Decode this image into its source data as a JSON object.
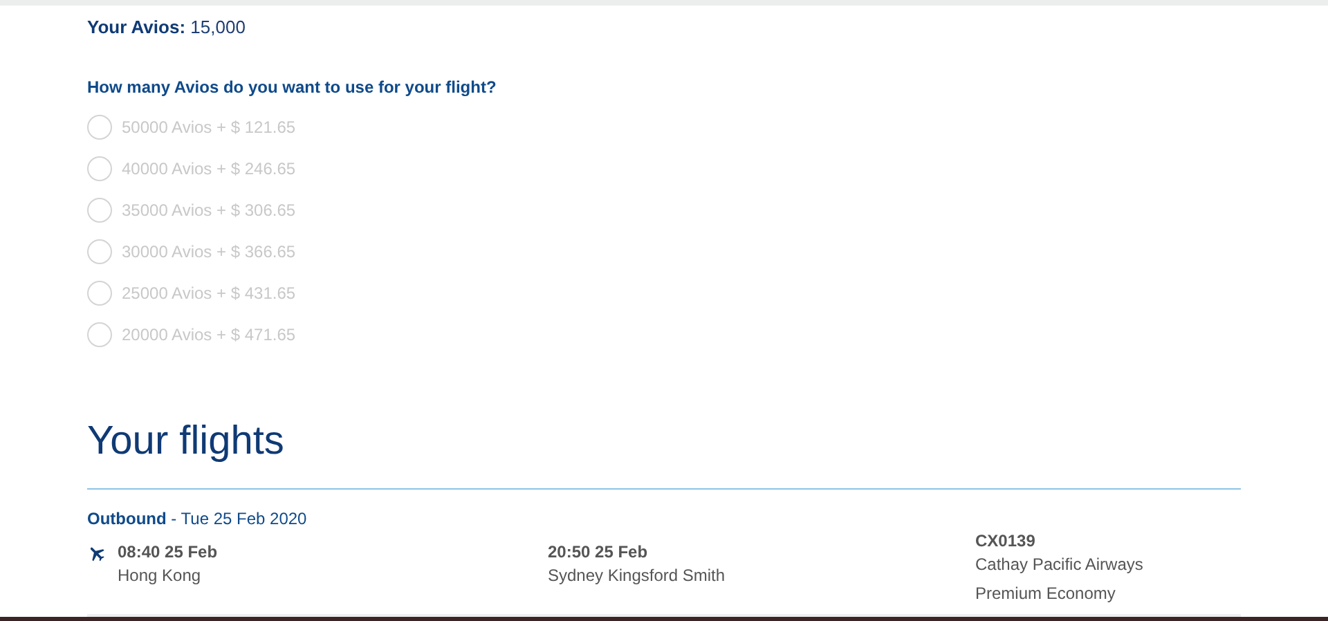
{
  "avios_balance": {
    "label": "Your Avios:",
    "value": "15,000"
  },
  "question": "How many Avios do you want to use for your flight?",
  "options": [
    {
      "label": "50000 Avios + $ 121.65",
      "selected": false,
      "disabled": true
    },
    {
      "label": "40000 Avios + $ 246.65",
      "selected": false,
      "disabled": true
    },
    {
      "label": "35000 Avios + $ 306.65",
      "selected": false,
      "disabled": true
    },
    {
      "label": "30000 Avios + $ 366.65",
      "selected": false,
      "disabled": true
    },
    {
      "label": "25000 Avios + $ 431.65",
      "selected": false,
      "disabled": true
    },
    {
      "label": "20000 Avios + $ 471.65",
      "selected": false,
      "disabled": true
    }
  ],
  "flights": {
    "title": "Your flights",
    "outbound": {
      "label": "Outbound",
      "date": "- Tue 25 Feb 2020",
      "departure": {
        "time": "08:40 25 Feb",
        "place": "Hong Kong"
      },
      "arrival": {
        "time": "20:50 25 Feb",
        "place": "Sydney Kingsford Smith"
      },
      "flight": {
        "number": "CX0139",
        "airline": "Cathay Pacific Airways",
        "cabin": "Premium Economy"
      }
    }
  }
}
